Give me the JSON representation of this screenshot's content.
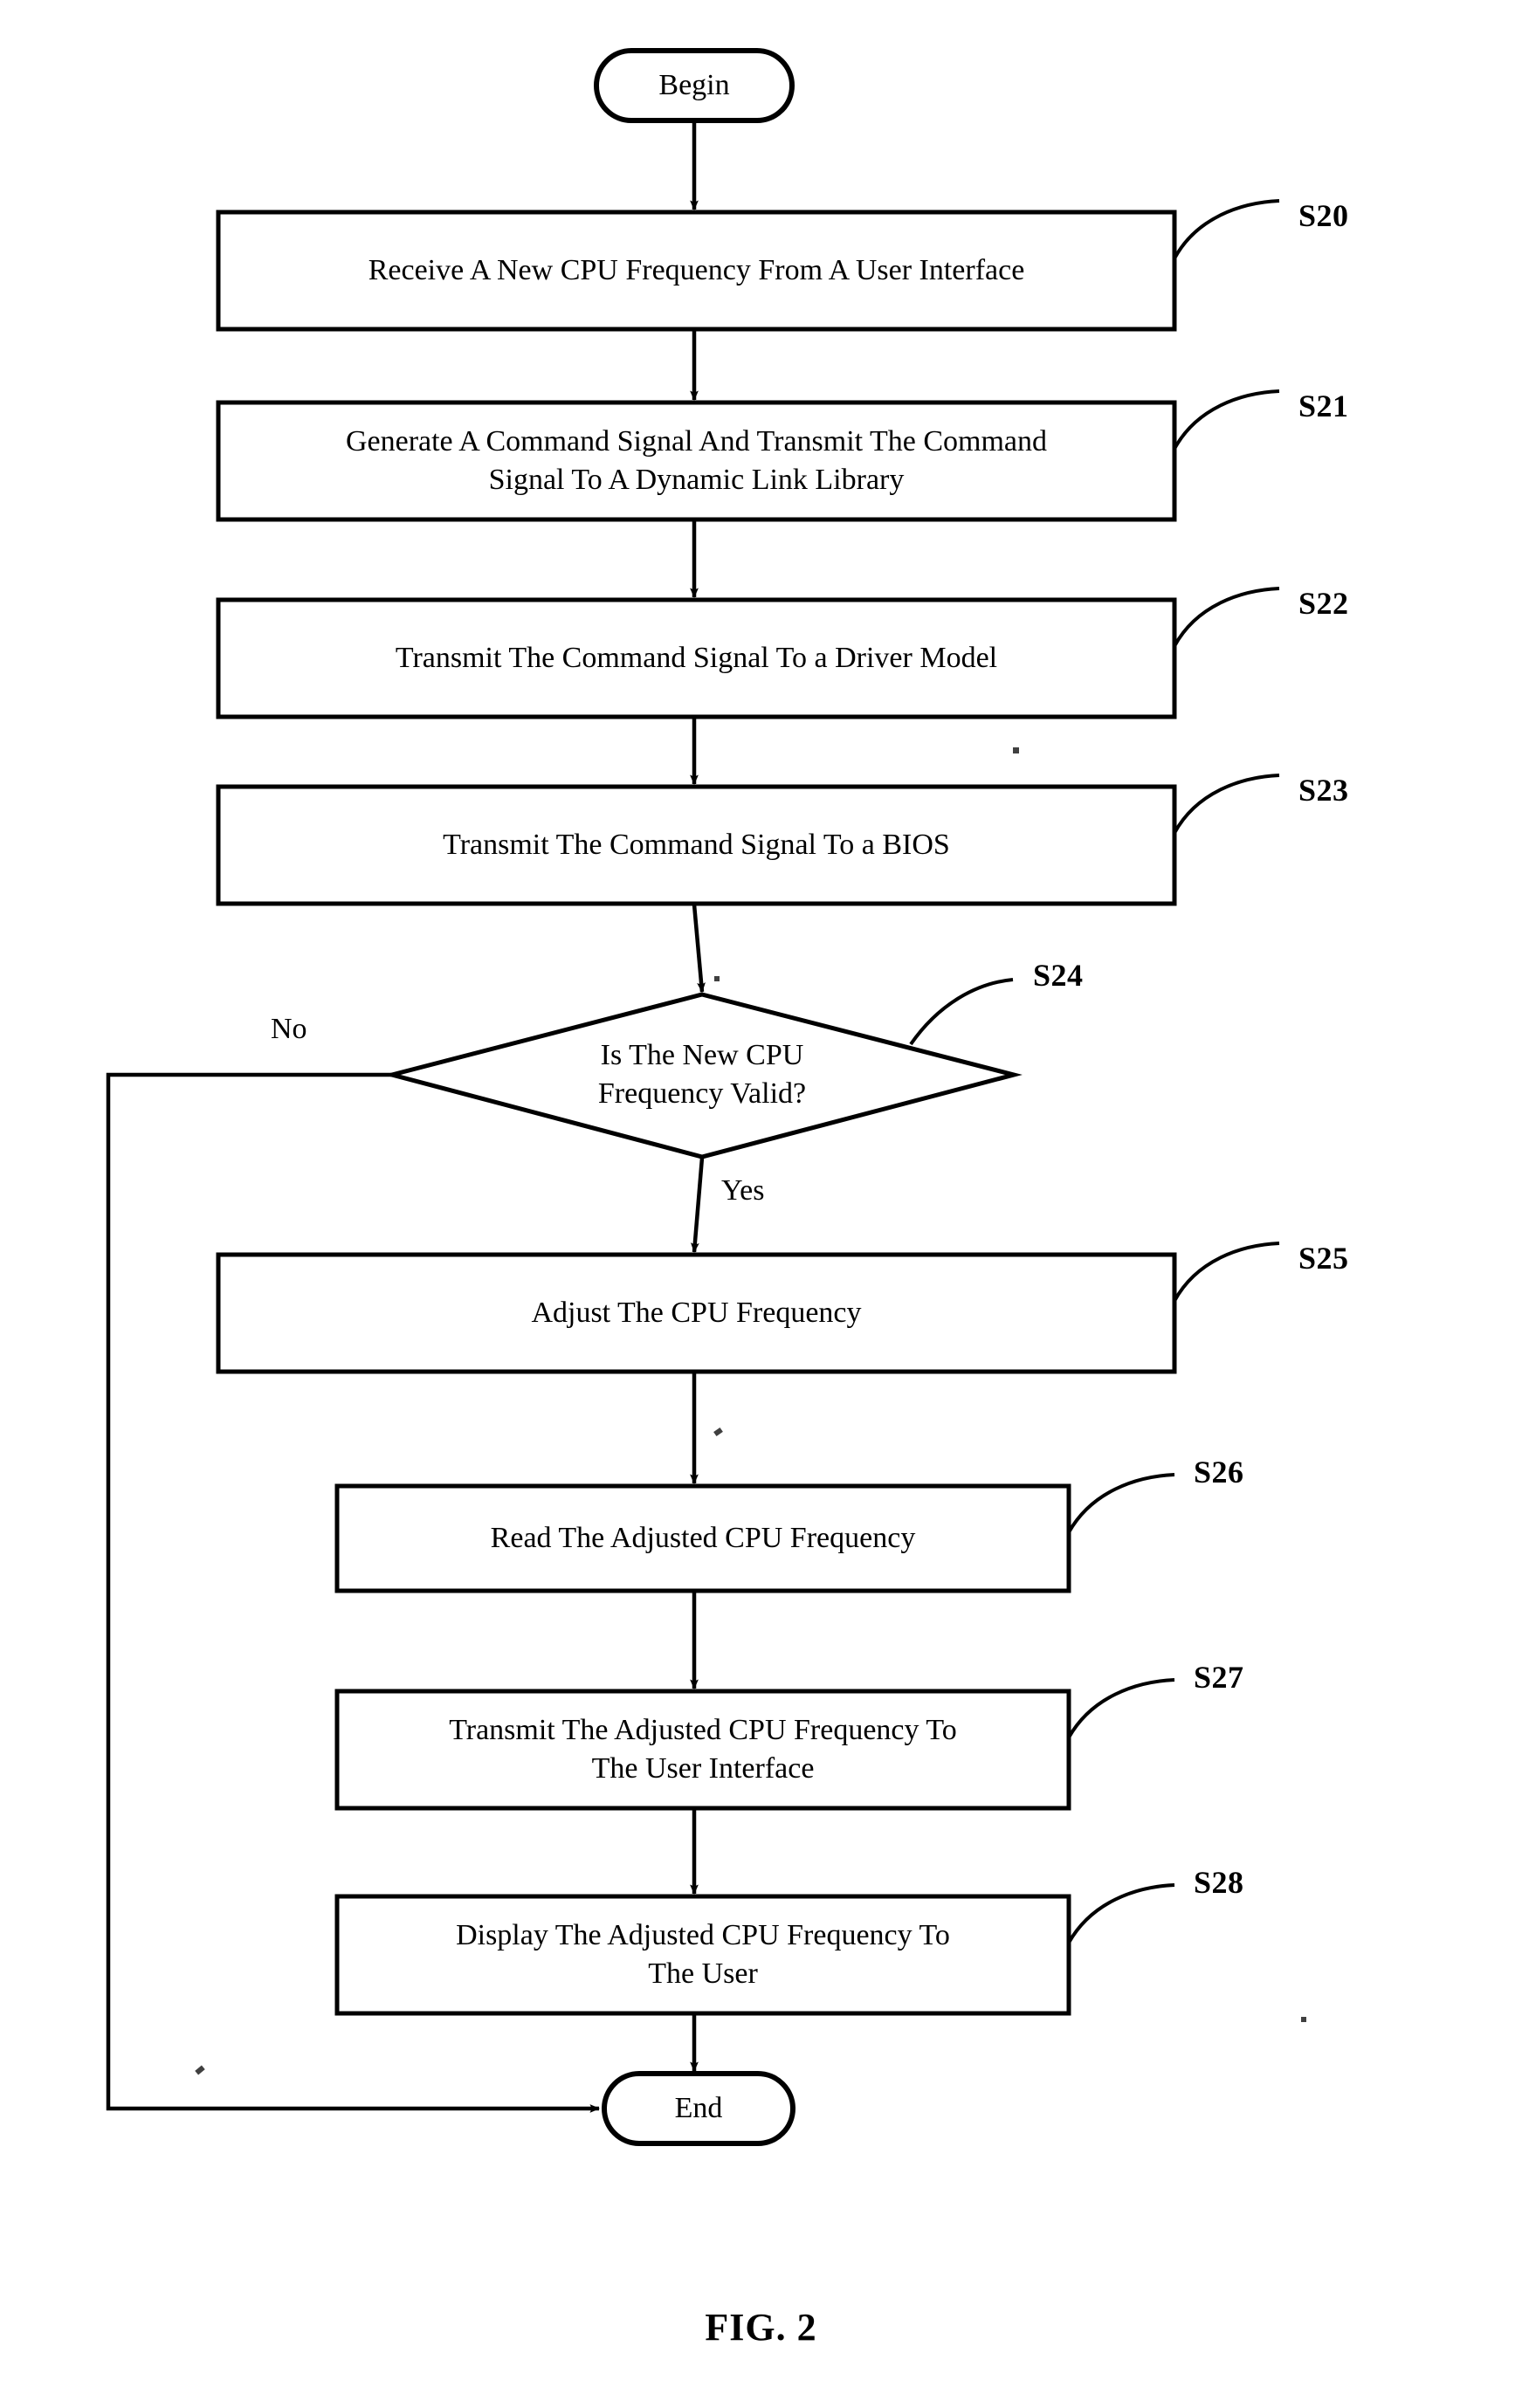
{
  "figure": {
    "caption": "FIG. 2"
  },
  "diagram": {
    "type": "flowchart",
    "orientation": "top-to-bottom",
    "nodes": [
      {
        "id": "begin",
        "shape": "terminator",
        "label": "Begin",
        "ref": ""
      },
      {
        "id": "s20",
        "shape": "process",
        "label": "Receive A New CPU Frequency From A User Interface",
        "ref": "S20"
      },
      {
        "id": "s21",
        "shape": "process",
        "label": "Generate A Command Signal And Transmit The Command\nSignal To A Dynamic Link Library",
        "ref": "S21"
      },
      {
        "id": "s22",
        "shape": "process",
        "label": "Transmit The Command Signal To a Driver Model",
        "ref": "S22"
      },
      {
        "id": "s23",
        "shape": "process",
        "label": "Transmit The Command Signal To a BIOS",
        "ref": "S23"
      },
      {
        "id": "s24",
        "shape": "decision",
        "label": "Is The New CPU\nFrequency Valid?",
        "ref": "S24"
      },
      {
        "id": "s25",
        "shape": "process",
        "label": "Adjust The CPU Frequency",
        "ref": "S25"
      },
      {
        "id": "s26",
        "shape": "process",
        "label": "Read The Adjusted CPU Frequency",
        "ref": "S26"
      },
      {
        "id": "s27",
        "shape": "process",
        "label": "Transmit The Adjusted CPU Frequency To\nThe User Interface",
        "ref": "S27"
      },
      {
        "id": "s28",
        "shape": "process",
        "label": "Display The Adjusted CPU Frequency To\nThe User",
        "ref": "S28"
      },
      {
        "id": "end",
        "shape": "terminator",
        "label": "End",
        "ref": ""
      }
    ],
    "branch_labels": {
      "no": "No",
      "yes": "Yes"
    },
    "edges": [
      {
        "from": "begin",
        "to": "s20",
        "label": ""
      },
      {
        "from": "s20",
        "to": "s21",
        "label": ""
      },
      {
        "from": "s21",
        "to": "s22",
        "label": ""
      },
      {
        "from": "s22",
        "to": "s23",
        "label": ""
      },
      {
        "from": "s23",
        "to": "s24",
        "label": ""
      },
      {
        "from": "s24",
        "to": "s25",
        "label": "Yes"
      },
      {
        "from": "s24",
        "to": "end",
        "label": "No"
      },
      {
        "from": "s25",
        "to": "s26",
        "label": ""
      },
      {
        "from": "s26",
        "to": "s27",
        "label": ""
      },
      {
        "from": "s27",
        "to": "s28",
        "label": ""
      },
      {
        "from": "s28",
        "to": "end",
        "label": ""
      }
    ],
    "colors": {
      "stroke": "#000000",
      "fill": "#ffffff",
      "text": "#000000"
    }
  }
}
